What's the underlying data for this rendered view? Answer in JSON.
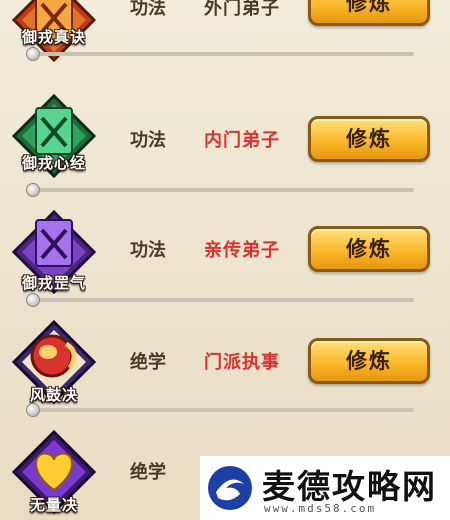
{
  "skills": [
    {
      "name": "御戎真诀",
      "type": "功法",
      "rank": "外门弟子",
      "rank_color": "#4a3a2a",
      "action": "修炼",
      "theme": "orange",
      "icon": "crossed-swords-banner-icon"
    },
    {
      "name": "御戎心经",
      "type": "功法",
      "rank": "内门弟子",
      "rank_color": "#d8332f",
      "action": "修炼",
      "theme": "green",
      "icon": "crossed-swords-banner-icon"
    },
    {
      "name": "御戎罡气",
      "type": "功法",
      "rank": "亲传弟子",
      "rank_color": "#d8332f",
      "action": "修炼",
      "theme": "purple",
      "icon": "crossed-swords-banner-icon"
    },
    {
      "name": "风鼓决",
      "type": "绝学",
      "rank": "门派执事",
      "rank_color": "#d8332f",
      "action": "修炼",
      "theme": "red",
      "icon": "war-drum-icon"
    },
    {
      "name": "无量决",
      "type": "绝学",
      "rank": "",
      "rank_color": "#d8332f",
      "action": "",
      "theme": "violet",
      "icon": "golden-heart-icon"
    }
  ],
  "watermark": {
    "title": "麦德攻略网",
    "url": "www.mds58.com",
    "icon": "swirl-logo-icon"
  }
}
